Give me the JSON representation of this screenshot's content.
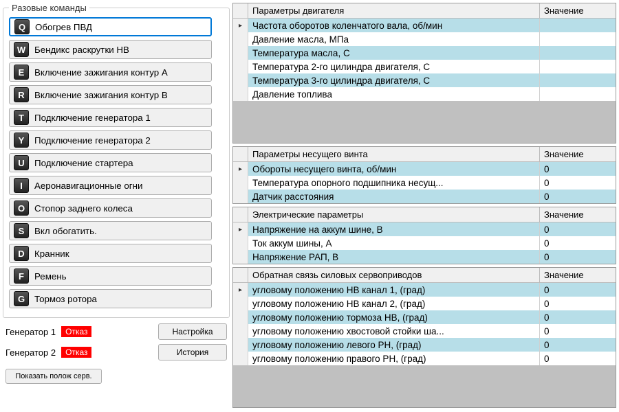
{
  "commands": {
    "legend": "Разовые команды",
    "items": [
      {
        "key": "Q",
        "label": "Обогрев ПВД",
        "selected": true
      },
      {
        "key": "W",
        "label": "Бендикс раскрутки НВ"
      },
      {
        "key": "E",
        "label": "Включение зажигания контур А"
      },
      {
        "key": "R",
        "label": "Включение зажигания контур В"
      },
      {
        "key": "T",
        "label": "Подключение генератора 1"
      },
      {
        "key": "Y",
        "label": "Подключение генератора 2"
      },
      {
        "key": "U",
        "label": "Подключение стартера"
      },
      {
        "key": "I",
        "label": "Аеронавигационные огни"
      },
      {
        "key": "O",
        "label": "Стопор заднего колеса"
      },
      {
        "key": "S",
        "label": "Вкл обогатить."
      },
      {
        "key": "D",
        "label": "Кранник"
      },
      {
        "key": "F",
        "label": "Ремень"
      },
      {
        "key": "G",
        "label": "Тормоз ротора"
      }
    ]
  },
  "status": {
    "gen1_label": "Генератор 1",
    "gen1_badge": "Отказ",
    "gen2_label": "Генератор 2",
    "gen2_badge": "Отказ",
    "settings_btn": "Настройка",
    "history_btn": "История",
    "show_servo_btn": "Показать полож серв."
  },
  "tables": [
    {
      "col1": "Параметры двигателя",
      "col2": "Значение",
      "rows": [
        {
          "param": "Частота оборотов коленчатого вала, об/мин",
          "val": ""
        },
        {
          "param": "Давление масла, МПа",
          "val": ""
        },
        {
          "param": "Температура масла, С",
          "val": ""
        },
        {
          "param": "Температура 2-го цилиндра двигателя, С",
          "val": ""
        },
        {
          "param": "Температура 3-го цилиндра двигателя, С",
          "val": ""
        },
        {
          "param": "Давление топлива",
          "val": ""
        }
      ],
      "flex": true
    },
    {
      "col1": "Параметры несущего винта",
      "col2": "Значение",
      "rows": [
        {
          "param": "Обороты несущего винта, об/мин",
          "val": "0"
        },
        {
          "param": "Температура опорного подшипника несущ...",
          "val": "0"
        },
        {
          "param": "Датчик расстояния",
          "val": "0"
        }
      ]
    },
    {
      "col1": "Электрические параметры",
      "col2": "Значение",
      "rows": [
        {
          "param": "Напряжение на аккум шине, В",
          "val": "0"
        },
        {
          "param": "Ток аккум шины, А",
          "val": "0"
        },
        {
          "param": "Напряжение РАП, В",
          "val": "0"
        }
      ]
    },
    {
      "col1": "Обратная связь силовых сервоприводов",
      "col2": "Значение",
      "rows": [
        {
          "param": "угловому положению НВ канал 1, (град)",
          "val": "0"
        },
        {
          "param": "угловому положению НВ канал 2, (град)",
          "val": "0"
        },
        {
          "param": "угловому положению тормоза НВ, (град)",
          "val": "0"
        },
        {
          "param": "угловому положению хвостовой стойки ша...",
          "val": "0"
        },
        {
          "param": "угловому положению левого РН, (град)",
          "val": "0"
        },
        {
          "param": "угловому положению правого РН, (град)",
          "val": "0"
        }
      ],
      "flex": true
    }
  ]
}
